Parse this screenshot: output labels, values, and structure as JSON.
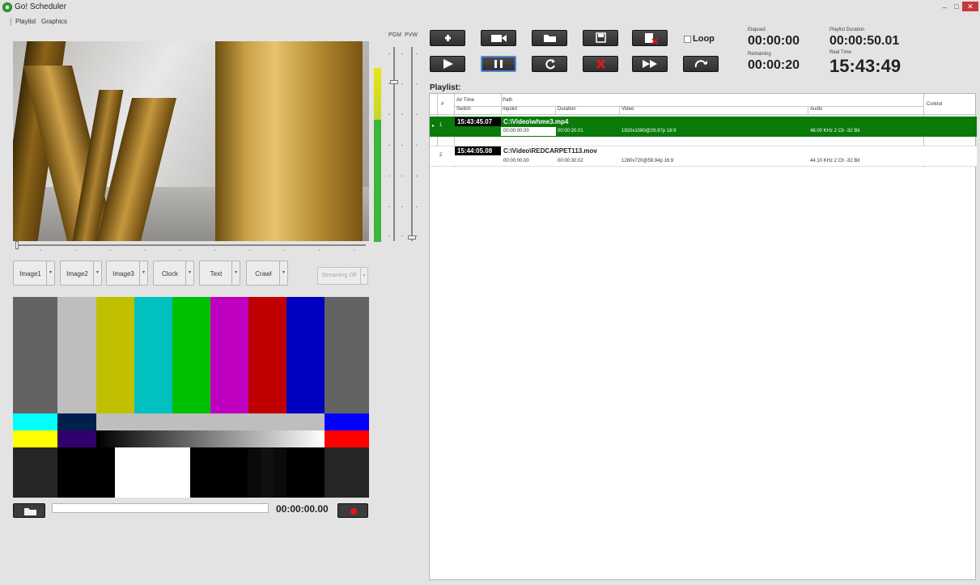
{
  "window": {
    "title": "Go! Scheduler",
    "minimize_glyph": "–",
    "maximize_glyph": "&#x1F5D7;",
    "close_glyph": "✕"
  },
  "menu": {
    "items": [
      "Playlist",
      "Graphics"
    ]
  },
  "meters": {
    "pgm_label": "PGM",
    "pvw_label": "PVW"
  },
  "graphics_buttons": [
    {
      "label": "Image1"
    },
    {
      "label": "Image2"
    },
    {
      "label": "Image3"
    },
    {
      "label": "Clock"
    },
    {
      "label": "Text"
    },
    {
      "label": "Crawl"
    }
  ],
  "streaming": {
    "label": "Streaming Off"
  },
  "record": {
    "path_value": "",
    "timecode": "00:00:00.00"
  },
  "transport": {
    "loop_label": "Loop",
    "loop_checked": false,
    "icons": [
      "add-icon",
      "camera-icon",
      "open-folder-icon",
      "save-icon",
      "clear-playlist-icon",
      "play-icon",
      "pause-icon",
      "restart-icon",
      "stop-icon",
      "fast-forward-icon",
      "skip-icon"
    ]
  },
  "times": {
    "elapsed_label": "Elapsed",
    "elapsed": "00:00:00",
    "remaining_label": "Remaining",
    "remaining": "00:00:20",
    "playlist_duration_label": "Playlist Duration",
    "playlist_duration": "00:00:50.01",
    "real_time_label": "Real Time",
    "real_time": "15:43:49"
  },
  "playlist": {
    "title": "Playlist:",
    "headers": {
      "num": "#",
      "air_time": "Air Time",
      "switch": "Switch",
      "path": "Path",
      "inpoint": "Inpoint",
      "duration": "Duration",
      "video": "Video",
      "audio": "Audio",
      "control": "Control"
    },
    "rows": [
      {
        "num": "1",
        "air_time": "15:43:45.07",
        "path": "C:\\Video\\whme3.mp4",
        "inpoint": "00:00:00.00",
        "duration": "00:00:20.01",
        "video": "1920x1080@29.97p 16:9",
        "audio": "48.00 KHz 2 Ch -32 Bit",
        "active": true,
        "row_color": "#0a7a0a"
      },
      {
        "num": "2",
        "air_time": "15:44:05.08",
        "path": "C:\\Video\\REDCARPET113.mov",
        "inpoint": "00:00:00.00",
        "duration": "00:00:30.02",
        "video": "1280x720@59.94p 16:9",
        "audio": "44.10 KHz 2 Ch -32 Bit",
        "active": false,
        "row_color": "#ffffff"
      }
    ]
  },
  "colors": {
    "active_row": "#0a7a0a",
    "button_dark": "#333333",
    "record_red": "#e01818",
    "close_red": "#c7383a"
  }
}
